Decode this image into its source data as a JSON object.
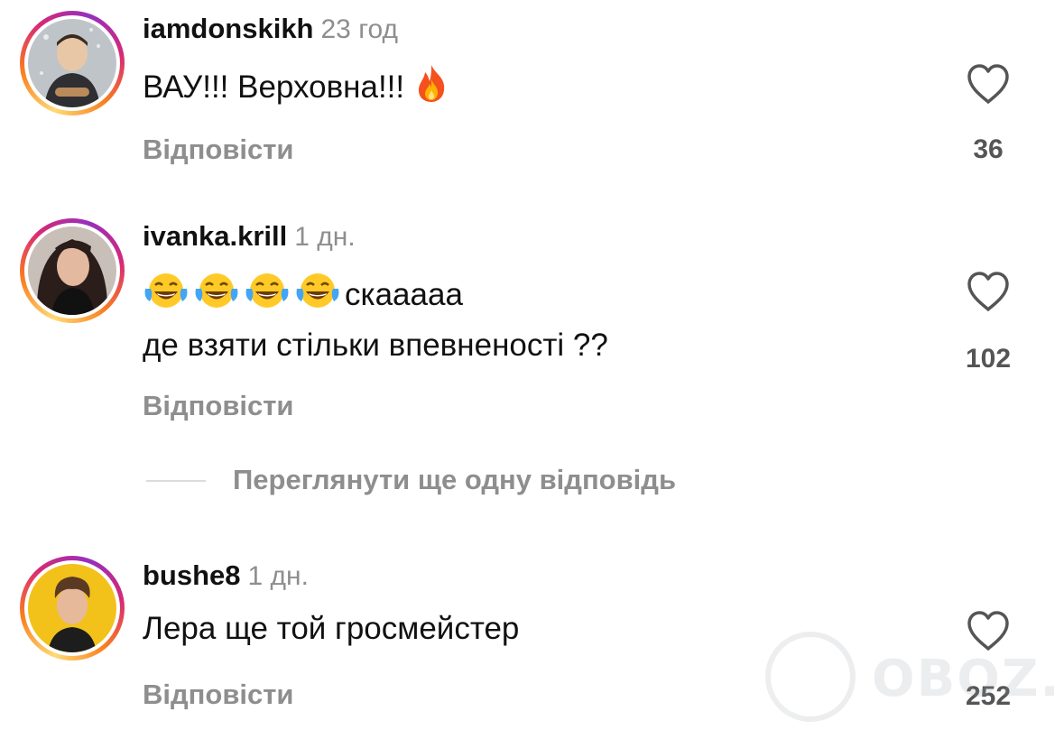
{
  "comments": [
    {
      "username": "iamdonskikh",
      "time": "23 год",
      "lines": [
        "ВАУ!!! Верховна!!!"
      ],
      "emoji": "fire",
      "reply_label": "Відповісти",
      "likes": "36"
    },
    {
      "username": "ivanka.krill",
      "time": "1 дн.",
      "lines": [
        "скааааа",
        "де взяти стільки впевненості ??"
      ],
      "emoji": "laughing-tears",
      "reply_label": "Відповісти",
      "likes": "102"
    },
    {
      "username": "bushe8",
      "time": "1 дн.",
      "lines": [
        "Лера ще той гросмейстер"
      ],
      "reply_label": "Відповісти",
      "likes": "252"
    }
  ],
  "view_more_label": "Переглянути ще одну відповідь",
  "watermark": "OBOZ.UA",
  "colors": {
    "muted": "#8e8e8e",
    "ring_start": "#feda75",
    "ring_mid": "#d62976",
    "ring_end": "#962fbf"
  }
}
